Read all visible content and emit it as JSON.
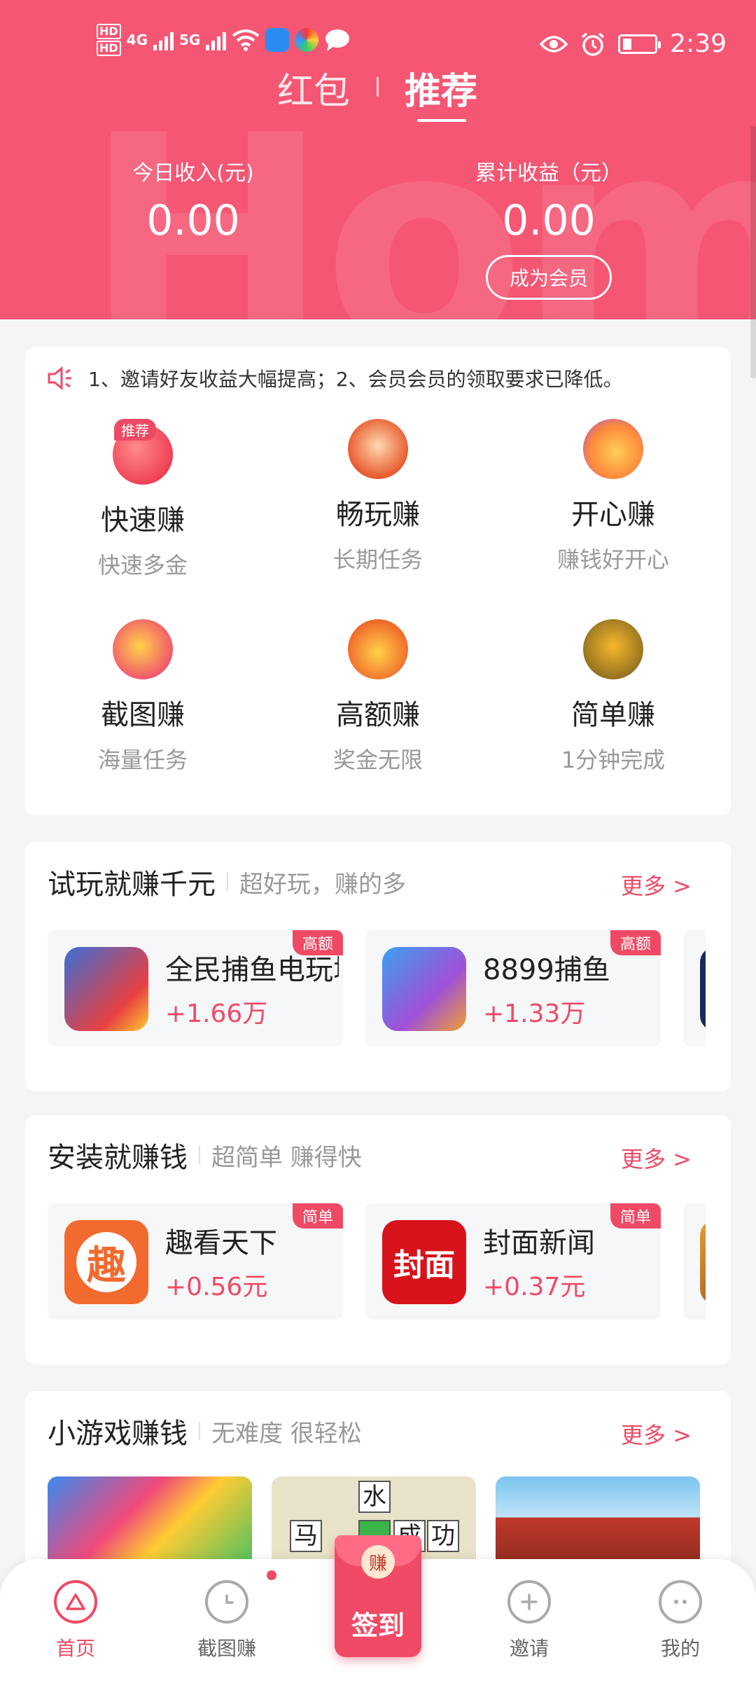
{
  "status_bar": {
    "hd1": "HD",
    "hd2": "HD",
    "net1": "4G",
    "net2": "5G",
    "time": "2:39"
  },
  "tabs": [
    {
      "label": "红包"
    },
    {
      "label": "推荐"
    }
  ],
  "watermark": "Hom",
  "stats": {
    "today_label": "今日收入(元)",
    "today_value": "0.00",
    "total_label": "累计收益（元）",
    "total_value": "0.00",
    "member_button": "成为会员"
  },
  "notice": "1、邀请好友收益大幅提高；2、会员会员的领取要求已降低。",
  "grid": [
    {
      "title": "快速赚",
      "sub": "快速多金",
      "badge": "推荐",
      "color": "#f24a5e",
      "icon": "red-envelope-icon"
    },
    {
      "title": "畅玩赚",
      "sub": "长期任务",
      "color": "#e85a2e",
      "icon": "fortune-god-icon"
    },
    {
      "title": "开心赚",
      "sub": "赚钱好开心",
      "color": "#a250e0",
      "icon": "treasure-chest-icon"
    },
    {
      "title": "截图赚",
      "sub": "海量任务",
      "color": "#f0506e",
      "icon": "coins-icon"
    },
    {
      "title": "高额赚",
      "sub": "奖金无限",
      "color": "#f06a2a",
      "icon": "money-bag-icon"
    },
    {
      "title": "简单赚",
      "sub": "1分钟完成",
      "color": "#d09a20",
      "icon": "game-character-icon"
    }
  ],
  "sections": {
    "play": {
      "title": "试玩就赚千元",
      "sub": "超好玩，赚的多",
      "more": "更多 >",
      "apps": [
        {
          "name": "全民捕鱼电玩城",
          "reward": "+1.66万",
          "tag": "高额"
        },
        {
          "name": "8899捕鱼",
          "reward": "+1.33万",
          "tag": "高额"
        }
      ]
    },
    "install": {
      "title": "安装就赚钱",
      "sub": "超简单 赚得快",
      "more": "更多 >",
      "apps": [
        {
          "name": "趣看天下",
          "reward": "+0.56元",
          "tag": "简单",
          "icon_text": "趣"
        },
        {
          "name": "封面新闻",
          "reward": "+0.37元",
          "tag": "简单",
          "icon_text": "封面"
        }
      ]
    },
    "games": {
      "title": "小游戏赚钱",
      "sub": "无难度 很轻松",
      "more": "更多 >",
      "word_tiles": [
        "水",
        "马",
        "成",
        "功"
      ]
    }
  },
  "nav": {
    "home": "首页",
    "screenshot": "截图赚",
    "checkin_coin": "赚",
    "checkin": "签到",
    "invite": "邀请",
    "mine": "我的"
  },
  "colors": {
    "brand": "#f55673",
    "accent": "#ef4a65",
    "muted": "#999999"
  }
}
